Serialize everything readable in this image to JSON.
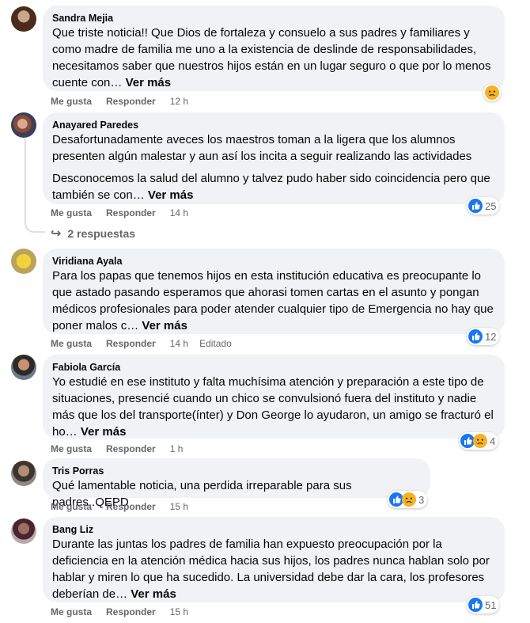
{
  "labels": {
    "like": "Me gusta",
    "reply": "Responder",
    "see_more": "Ver más"
  },
  "comments": [
    {
      "author": "Sandra Mejia",
      "text": "Que triste noticia!! Que Dios de fortaleza y consuelo a sus padres y familiares y como madre de familia me uno a la existencia de deslinde de responsabilidades, necesitamos saber que nuestros hijos están en un lugar seguro o que por lo menos cuente con…",
      "time": "12 h",
      "reactions": [
        "sad"
      ],
      "reaction_count": ""
    },
    {
      "author": "Anayared Paredes",
      "text": "Desafortunadamente aveces los maestros toman a la ligera que los alumnos presenten algún malestar y aun así los incita a seguir realizando las actividades",
      "text2": "Desconocemos la salud del alumno y talvez pudo haber sido coincidencia pero que también se con…",
      "time": "14 h",
      "reactions": [
        "like"
      ],
      "reaction_count": "25",
      "replies": "2 respuestas"
    },
    {
      "author": "Viridiana Ayala",
      "text": "Para los papas que tenemos hijos en esta institución educativa es preocupante lo que astado pasando esperamos que ahorasi tomen cartas en el asunto y pongan médicos profesionales para poder atender cualquier tipo de Emergencia no hay que poner malos c…",
      "time": "14 h",
      "edited": "Editado",
      "reactions": [
        "like"
      ],
      "reaction_count": "12"
    },
    {
      "author": "Fabiola García",
      "text": "Yo estudié en ese instituto y falta muchísima atención y preparación a este tipo de situaciones, presencié cuando un chico se convulsionó fuera del instituto y nadie más que los del transporte(ínter) y Don George lo ayudaron, un amigo se fracturó el ho…",
      "time": "1 h",
      "reactions": [
        "like",
        "sad"
      ],
      "reaction_count": "4"
    },
    {
      "author": "Tris Porras",
      "text": "Qué lamentable noticia, una perdida irreparable para sus padres..QEPD",
      "time": "15 h",
      "reactions": [
        "like",
        "sad"
      ],
      "reaction_count": "3"
    },
    {
      "author": "Bang Liz",
      "text": "Durante las juntas los padres de familia han expuesto preocupación por la deficiencia en la atención médica hacia sus hijos, los padres nunca hablan solo por hablar y miren lo que ha sucedido. La universidad debe dar la cara, los profesores deberían de…",
      "time": "15 h",
      "reactions": [
        "like"
      ],
      "reaction_count": "51"
    }
  ]
}
